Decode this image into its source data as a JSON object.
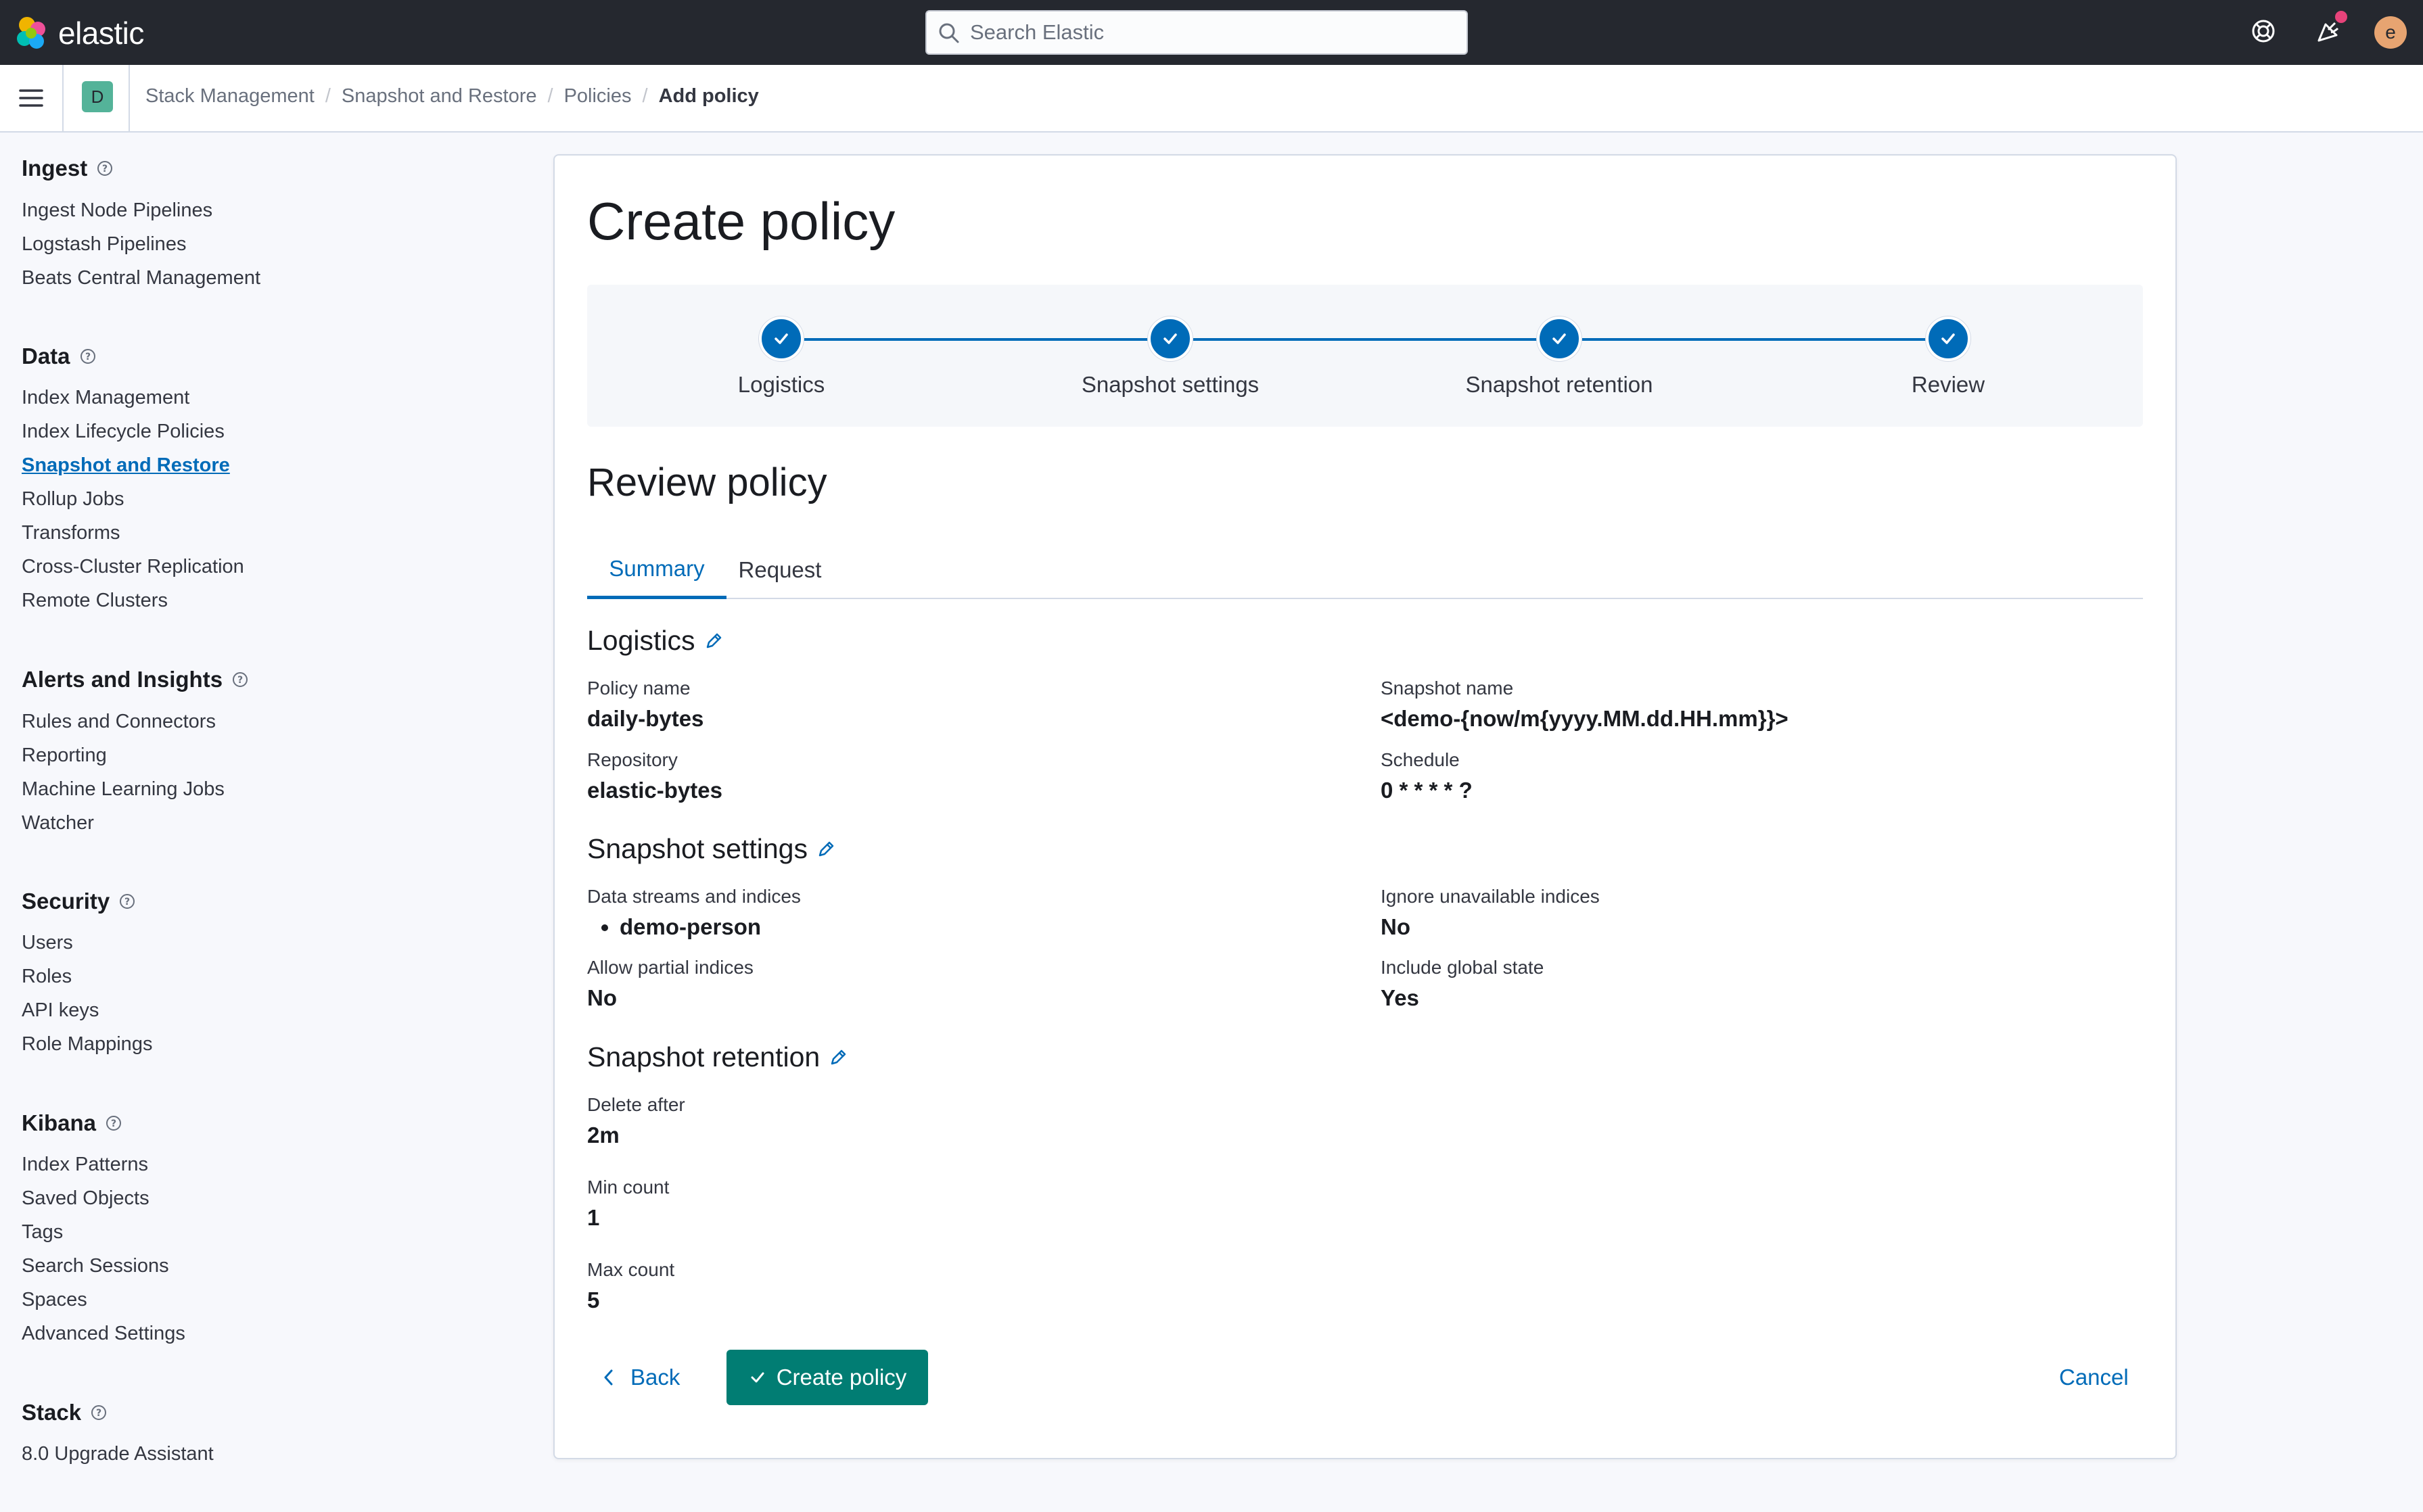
{
  "header": {
    "brand": "elastic",
    "search_placeholder": "Search Elastic",
    "icons": [
      "help-icon",
      "newsfeed-icon",
      "user-avatar"
    ],
    "avatar_initial": "e"
  },
  "breadcrumbs": {
    "space_initial": "D",
    "items": [
      "Stack Management",
      "Snapshot and Restore",
      "Policies",
      "Add policy"
    ]
  },
  "sidebar": {
    "groups": [
      {
        "title": "Ingest",
        "items": [
          "Ingest Node Pipelines",
          "Logstash Pipelines",
          "Beats Central Management"
        ]
      },
      {
        "title": "Data",
        "items": [
          "Index Management",
          "Index Lifecycle Policies",
          "Snapshot and Restore",
          "Rollup Jobs",
          "Transforms",
          "Cross-Cluster Replication",
          "Remote Clusters"
        ]
      },
      {
        "title": "Alerts and Insights",
        "items": [
          "Rules and Connectors",
          "Reporting",
          "Machine Learning Jobs",
          "Watcher"
        ]
      },
      {
        "title": "Security",
        "items": [
          "Users",
          "Roles",
          "API keys",
          "Role Mappings"
        ]
      },
      {
        "title": "Kibana",
        "items": [
          "Index Patterns",
          "Saved Objects",
          "Tags",
          "Search Sessions",
          "Spaces",
          "Advanced Settings"
        ]
      },
      {
        "title": "Stack",
        "items": [
          "8.0 Upgrade Assistant"
        ]
      }
    ],
    "active_item": "Snapshot and Restore"
  },
  "main": {
    "page_title": "Create policy",
    "steps": [
      "Logistics",
      "Snapshot settings",
      "Snapshot retention",
      "Review"
    ],
    "review_title": "Review policy",
    "tabs": [
      "Summary",
      "Request"
    ],
    "logistics": {
      "title": "Logistics",
      "policy_name_label": "Policy name",
      "policy_name": "daily-bytes",
      "snapshot_name_label": "Snapshot name",
      "snapshot_name": "<demo-{now/m{yyyy.MM.dd.HH.mm}}>",
      "repository_label": "Repository",
      "repository": "elastic-bytes",
      "schedule_label": "Schedule",
      "schedule": "0 * * * * ?"
    },
    "settings": {
      "title": "Snapshot settings",
      "indices_label": "Data streams and indices",
      "indices": [
        "demo-person"
      ],
      "ignore_unavailable_label": "Ignore unavailable indices",
      "ignore_unavailable": "No",
      "allow_partial_label": "Allow partial indices",
      "allow_partial": "No",
      "include_global_label": "Include global state",
      "include_global": "Yes"
    },
    "retention": {
      "title": "Snapshot retention",
      "delete_after_label": "Delete after",
      "delete_after": "2m",
      "min_count_label": "Min count",
      "min_count": "1",
      "max_count_label": "Max count",
      "max_count": "5"
    },
    "actions": {
      "back": "Back",
      "create": "Create policy",
      "cancel": "Cancel"
    }
  },
  "colors": {
    "header_bg": "#25282f",
    "primary": "#006bb8",
    "success": "#017d73",
    "notification": "#e7437a"
  }
}
